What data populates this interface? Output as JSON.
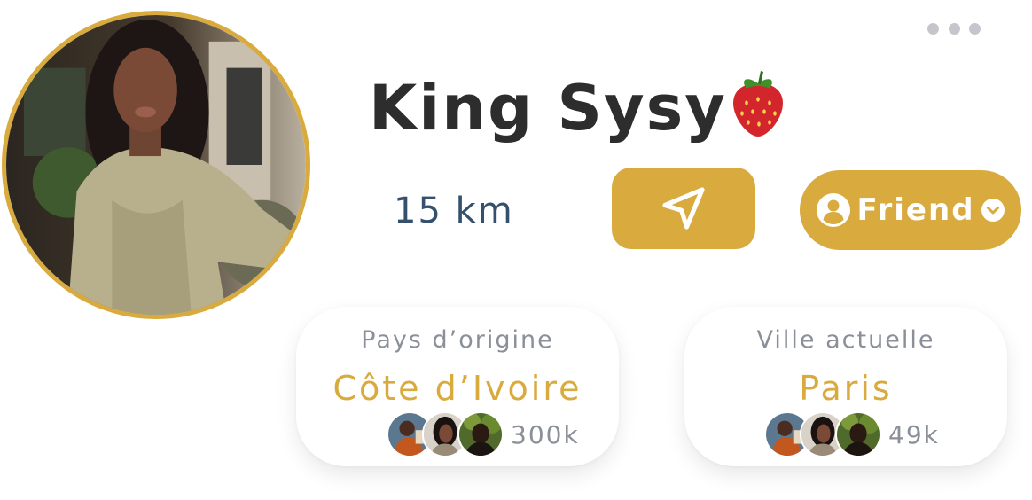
{
  "profile": {
    "name": "King Sysy",
    "name_emoji": "strawberry",
    "distance": "15 km",
    "avatar_icon": "profile-photo"
  },
  "actions": {
    "navigate_icon": "navigation-arrow-icon",
    "friend_label": "Friend",
    "friend_icon": "user-circle-icon",
    "dropdown_icon": "chevron-down-icon",
    "more_icon": "more-dots-icon"
  },
  "cards": {
    "origin": {
      "title": "Pays d’origine",
      "value": "Côte d’Ivoire",
      "count": "300k"
    },
    "city": {
      "title": "Ville actuelle",
      "value": "Paris",
      "count": "49k"
    }
  },
  "colors": {
    "accent": "#d9ab3f",
    "name": "#2d2d2d",
    "distance": "#34506c",
    "muted": "#8a8f98"
  }
}
